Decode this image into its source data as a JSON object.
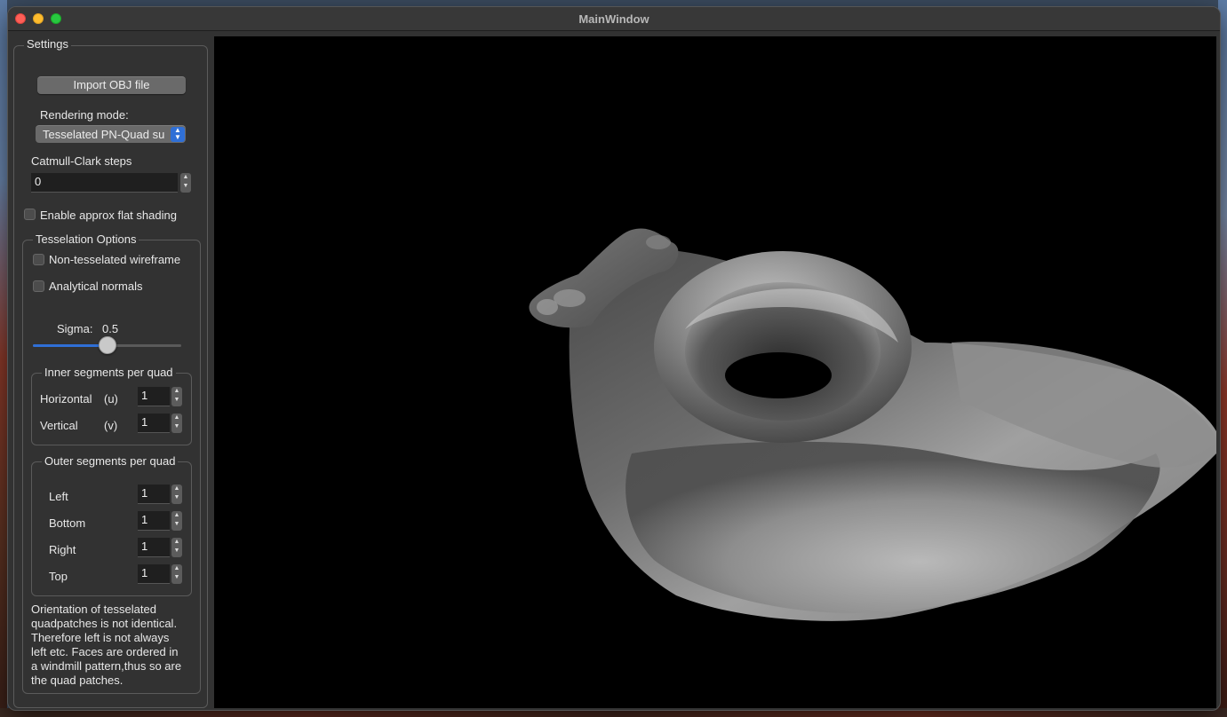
{
  "window": {
    "title": "MainWindow"
  },
  "settings": {
    "title": "Settings",
    "import_button": "Import OBJ file",
    "rendering_mode_label": "Rendering mode:",
    "rendering_mode_value": "Tesselated PN-Quad su",
    "catmull_label": "Catmull-Clark steps",
    "catmull_value": "0",
    "flat_shading_label": "Enable approx flat shading",
    "flat_shading_checked": false
  },
  "tess": {
    "title": "Tesselation Options",
    "wireframe_label": "Non-tesselated wireframe",
    "wireframe_checked": false,
    "analytical_label": "Analytical normals",
    "analytical_checked": false,
    "sigma_label": "Sigma:",
    "sigma_value": "0.5",
    "sigma_fraction": 0.5
  },
  "inner": {
    "title": "Inner segments per quad",
    "horizontal_label": "Horizontal",
    "horizontal_unit": "(u)",
    "horizontal_value": "1",
    "vertical_label": "Vertical",
    "vertical_unit": "(v)",
    "vertical_value": "1"
  },
  "outer": {
    "title": "Outer segments per quad",
    "left_label": "Left",
    "left_value": "1",
    "bottom_label": "Bottom",
    "bottom_value": "1",
    "right_label": "Right",
    "right_value": "1",
    "top_label": "Top",
    "top_value": "1"
  },
  "note": {
    "line1": "Orientation of tesselated",
    "line2": "quadpatches is not identical.",
    "line3": "Therefore left is not always",
    "line4": "left etc. Faces are ordered in",
    "line5": "a windmill pattern,thus so are",
    "line6": "the quad patches."
  },
  "colors": {
    "accent": "#2f6fd6",
    "viewport_bg": "#000000",
    "panel_bg": "#323232"
  },
  "icons": {
    "spin": "spinbox-arrows-icon",
    "select": "dropdown-arrows-icon"
  }
}
